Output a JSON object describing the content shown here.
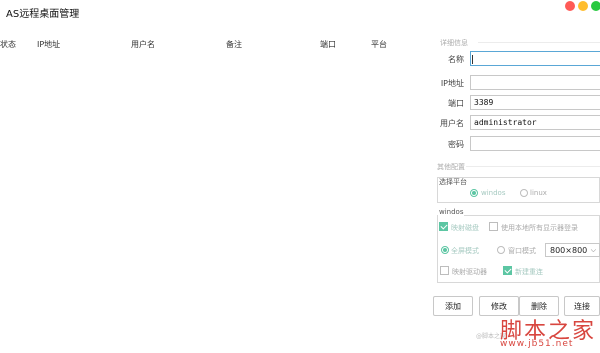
{
  "window": {
    "title": "AS远程桌面管理"
  },
  "table": {
    "columns": [
      "状态",
      "IP地址",
      "用户名",
      "备注",
      "端口",
      "平台"
    ],
    "rows": []
  },
  "panel": {
    "details_group": "详细信息",
    "name_label": "名称",
    "name_value": "",
    "ip_label": "IP地址",
    "ip_value": "",
    "port_label": "端口",
    "port_value": "3389",
    "user_label": "用户名",
    "user_value": "administrator",
    "password_label": "密码",
    "password_value": "",
    "other_group": "其他配置",
    "platform_label": "选择平台",
    "platform_options": [
      "windos",
      "linux"
    ],
    "platform_selected": "windos",
    "windos_group": "windos",
    "map_disk_label": "映射磁盘",
    "map_disk_checked": true,
    "use_all_monitors_label": "使用本地所有显示器登录",
    "use_all_monitors_checked": false,
    "fullscreen_label": "全屏模式",
    "window_mode_label": "窗口模式",
    "display_mode_selected": "fullscreen",
    "resolution_value": "800×800",
    "map_drive_label": "映射驱动器",
    "map_drive_checked": false,
    "new_label": "新建重连",
    "new_checked": true
  },
  "buttons": {
    "add": "添加",
    "edit": "修改",
    "delete": "删除",
    "connect": "连接"
  },
  "watermark": {
    "site_name": "脚本之家",
    "url": "www.jb51.net",
    "small_text": "@脚本之家"
  },
  "colors": {
    "accent": "#5cc6a3",
    "close": "#ff5b57",
    "minimize": "#ffbd2e",
    "maximize": "#29c940",
    "watermark": "#d8463f"
  }
}
